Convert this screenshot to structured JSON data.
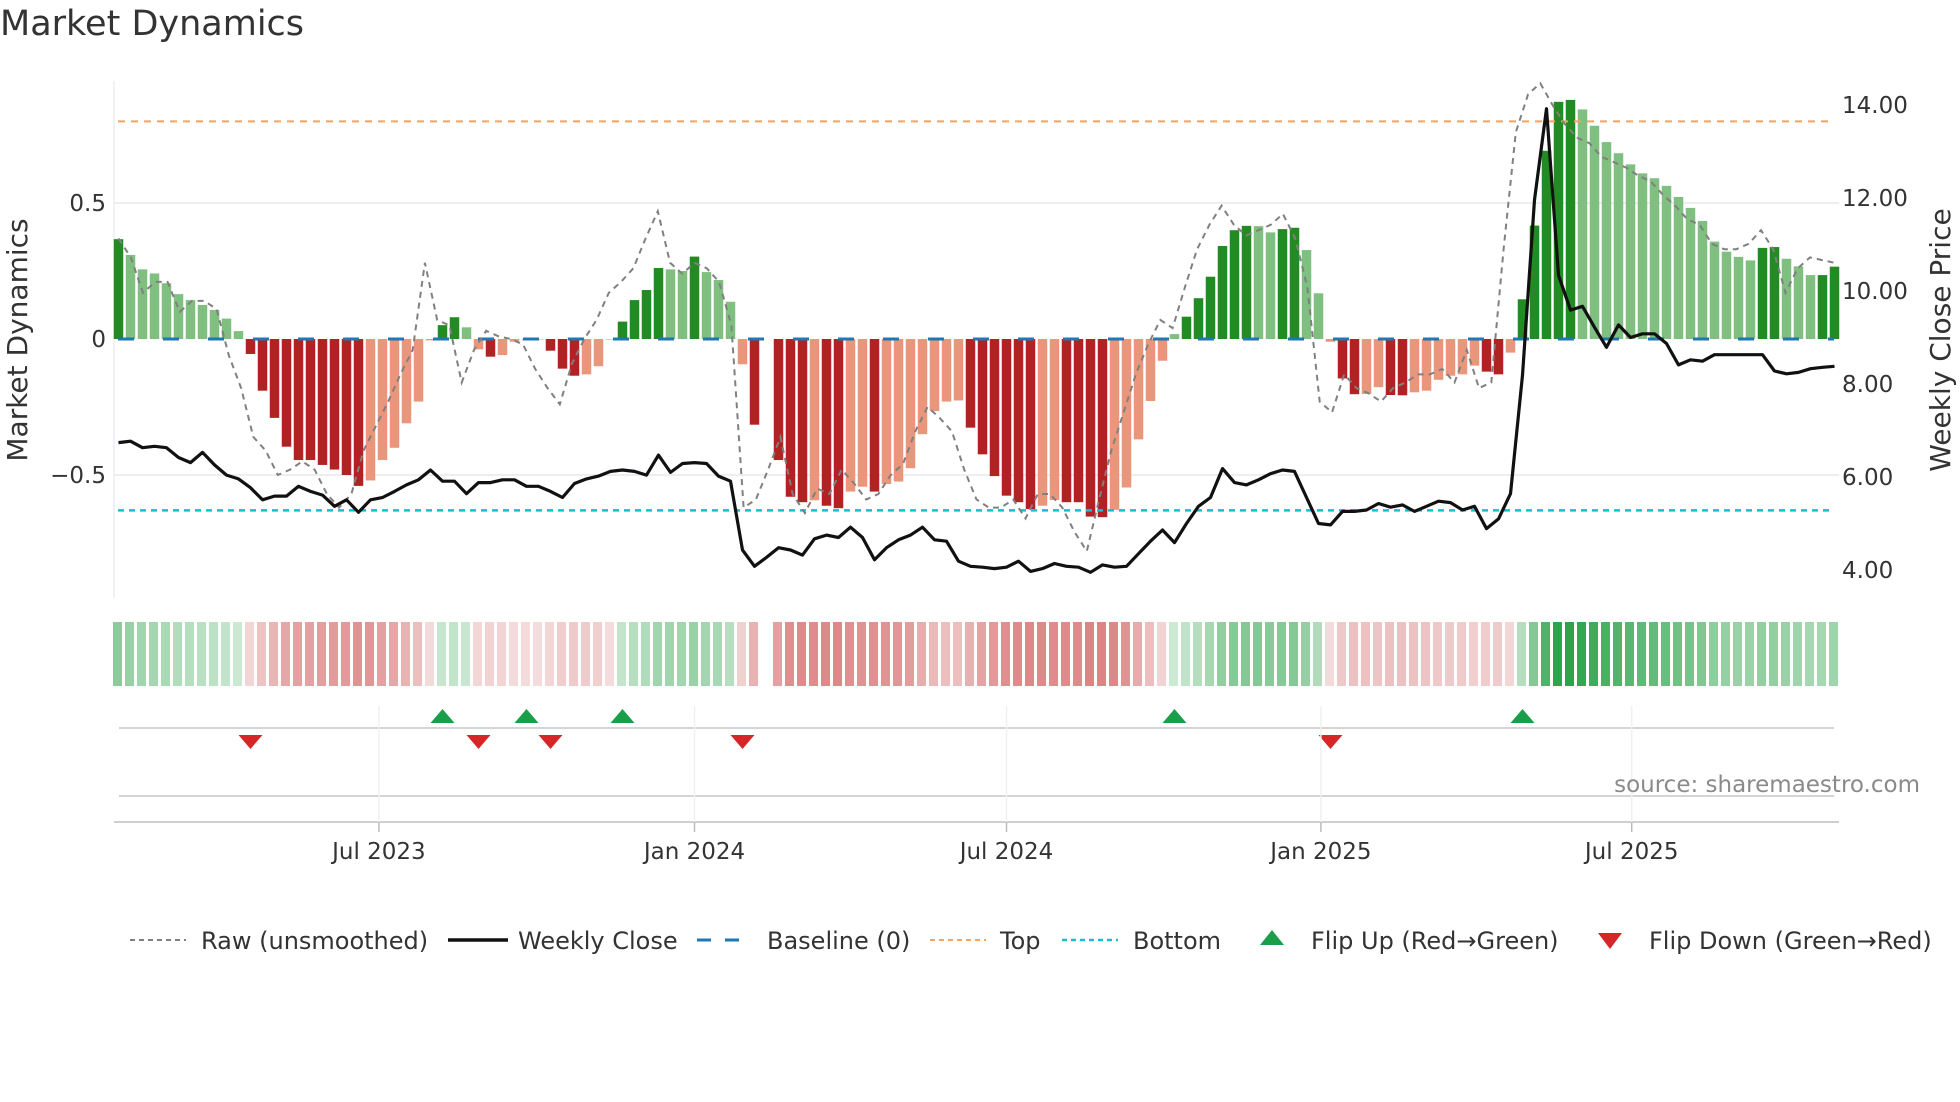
{
  "title": "Market Dynamics",
  "source": "source: sharemaestro.com",
  "chart_data": {
    "type": "bar",
    "title": "Market Dynamics",
    "ylabel": "Market Dynamics",
    "y2label": "Weekly Close Price",
    "ylim": [
      -0.9,
      1.0
    ],
    "y2lim": [
      3.3,
      14.6
    ],
    "frequency": "weekly",
    "yticks": [
      {
        "v": 0.5,
        "label": "0.5"
      },
      {
        "v": 0,
        "label": "0"
      },
      {
        "v": -0.5,
        "label": "−0.5"
      }
    ],
    "y2ticks": [
      {
        "v": 14,
        "label": "14.00"
      },
      {
        "v": 12,
        "label": "12.00"
      },
      {
        "v": 10,
        "label": "10.00"
      },
      {
        "v": 8,
        "label": "8.00"
      },
      {
        "v": 6,
        "label": "6.00"
      },
      {
        "v": 4,
        "label": "4.00"
      }
    ],
    "xticks": [
      {
        "week": 21.7,
        "label": "Jul 2023"
      },
      {
        "week": 48.0,
        "label": "Jan 2024"
      },
      {
        "week": 74.0,
        "label": "Jul 2024"
      },
      {
        "week": 100.2,
        "label": "Jan 2025"
      },
      {
        "week": 126.1,
        "label": "Jul 2025"
      }
    ],
    "levels": {
      "baseline": 0,
      "top": 0.8,
      "bottom": -0.63
    },
    "colors": {
      "strong_up": "#228b22",
      "weak_up": "#7fbf7f",
      "strong_down": "#b22222",
      "weak_down": "#e9967a",
      "baseline": "#1f77b4",
      "top": "#f4a460",
      "bottom": "#17becf",
      "raw": "#808080",
      "close": "#111111",
      "flip_up": "#1a9e4a",
      "flip_down": "#d62728"
    },
    "dynamics": [
      0.367,
      0.309,
      0.256,
      0.241,
      0.205,
      0.165,
      0.143,
      0.125,
      0.107,
      0.075,
      0.029,
      -0.055,
      -0.19,
      -0.29,
      -0.396,
      -0.445,
      -0.445,
      -0.463,
      -0.48,
      -0.5,
      -0.54,
      -0.52,
      -0.445,
      -0.4,
      -0.31,
      -0.23,
      -0.005,
      0.051,
      0.08,
      0.043,
      -0.038,
      -0.065,
      -0.059,
      -0.01,
      -0.003,
      -0.001,
      -0.043,
      -0.109,
      -0.135,
      -0.13,
      -0.1,
      -0.002,
      0.064,
      0.143,
      0.18,
      0.261,
      0.256,
      0.25,
      0.303,
      0.246,
      0.217,
      0.137,
      -0.093,
      -0.315,
      null,
      -0.445,
      -0.58,
      -0.6,
      -0.593,
      -0.613,
      -0.622,
      -0.561,
      -0.543,
      -0.561,
      -0.533,
      -0.524,
      -0.475,
      -0.35,
      -0.265,
      -0.23,
      -0.226,
      -0.326,
      -0.424,
      -0.504,
      -0.576,
      -0.6,
      -0.625,
      -0.613,
      -0.592,
      -0.6,
      -0.6,
      -0.653,
      -0.655,
      -0.628,
      -0.546,
      -0.369,
      -0.228,
      -0.08,
      0.018,
      0.082,
      0.15,
      0.229,
      0.342,
      0.4,
      0.416,
      0.415,
      0.392,
      0.404,
      0.409,
      0.327,
      0.168,
      -0.01,
      -0.145,
      -0.203,
      -0.202,
      -0.177,
      -0.206,
      -0.207,
      -0.196,
      -0.19,
      -0.15,
      -0.135,
      -0.13,
      -0.098,
      -0.12,
      -0.13,
      -0.05,
      0.146,
      0.417,
      0.692,
      0.872,
      0.879,
      0.844,
      0.784,
      0.724,
      0.683,
      0.642,
      0.609,
      0.591,
      0.563,
      0.522,
      0.482,
      0.434,
      0.358,
      0.321,
      0.302,
      0.289,
      0.335,
      0.338,
      0.295,
      0.267,
      0.235,
      0.235,
      0.266
    ],
    "raw": [
      0.37,
      0.3,
      0.17,
      0.21,
      0.21,
      0.1,
      0.14,
      0.14,
      0.11,
      -0.06,
      -0.18,
      -0.36,
      -0.41,
      -0.5,
      -0.48,
      -0.45,
      -0.48,
      -0.57,
      -0.62,
      -0.57,
      -0.41,
      -0.32,
      -0.23,
      -0.13,
      -0.04,
      0.28,
      0.07,
      0.05,
      -0.16,
      -0.04,
      0.03,
      0.01,
      0,
      -0.02,
      -0.11,
      -0.18,
      -0.24,
      -0.09,
      0,
      0.07,
      0.17,
      0.21,
      0.26,
      0.37,
      0.47,
      0.28,
      0.24,
      0.28,
      0.26,
      0.21,
      0.05,
      -0.62,
      -0.59,
      -0.48,
      -0.36,
      -0.57,
      -0.64,
      -0.55,
      -0.57,
      -0.48,
      -0.53,
      -0.59,
      -0.57,
      -0.5,
      -0.46,
      -0.34,
      -0.25,
      -0.29,
      -0.34,
      -0.48,
      -0.59,
      -0.62,
      -0.62,
      -0.59,
      -0.66,
      -0.57,
      -0.57,
      -0.62,
      -0.71,
      -0.78,
      -0.59,
      -0.41,
      -0.27,
      -0.13,
      -0.02,
      0.07,
      0.04,
      0.19,
      0.33,
      0.42,
      0.49,
      0.42,
      0.38,
      0.4,
      0.42,
      0.46,
      0.37,
      0.19,
      -0.23,
      -0.27,
      -0.13,
      -0.18,
      -0.2,
      -0.23,
      -0.18,
      -0.16,
      -0.13,
      -0.13,
      -0.11,
      -0.16,
      -0.04,
      -0.18,
      -0.16,
      0.33,
      0.76,
      0.9,
      0.94,
      0.86,
      0.79,
      0.74,
      0.72,
      0.67,
      0.65,
      0.63,
      0.6,
      0.58,
      0.53,
      0.49,
      0.44,
      0.42,
      0.35,
      0.33,
      0.33,
      0.35,
      0.4,
      0.33,
      0.17,
      0.26,
      0.3,
      0.29,
      0.28
    ],
    "close": [
      6.74,
      6.77,
      6.63,
      6.66,
      6.63,
      6.42,
      6.31,
      6.53,
      6.26,
      6.04,
      5.96,
      5.77,
      5.51,
      5.59,
      5.59,
      5.8,
      5.69,
      5.61,
      5.37,
      5.51,
      5.24,
      5.51,
      5.56,
      5.69,
      5.83,
      5.94,
      6.15,
      5.91,
      5.91,
      5.64,
      5.88,
      5.88,
      5.94,
      5.94,
      5.8,
      5.8,
      5.69,
      5.56,
      5.86,
      5.96,
      6.02,
      6.12,
      6.15,
      6.12,
      6.04,
      6.47,
      6.1,
      6.29,
      6.31,
      6.29,
      6.02,
      5.91,
      4.43,
      4.08,
      4.27,
      4.48,
      4.43,
      4.32,
      4.67,
      4.75,
      4.7,
      4.92,
      4.7,
      4.22,
      4.48,
      4.65,
      4.75,
      4.92,
      4.65,
      4.62,
      4.19,
      4.08,
      4.06,
      4.03,
      4.06,
      4.19,
      3.97,
      4.03,
      4.14,
      4.08,
      4.06,
      3.95,
      4.11,
      4.06,
      4.08,
      4.35,
      4.62,
      4.86,
      4.59,
      5.0,
      5.37,
      5.56,
      6.18,
      5.88,
      5.83,
      5.94,
      6.07,
      6.15,
      6.12,
      5.56,
      5.0,
      4.97,
      5.26,
      5.26,
      5.29,
      5.43,
      5.35,
      5.4,
      5.26,
      5.37,
      5.48,
      5.45,
      5.29,
      5.37,
      4.89,
      5.1,
      5.64,
      8.19,
      11.96,
      13.92,
      10.34,
      9.59,
      9.67,
      9.22,
      8.79,
      9.27,
      9.0,
      9.08,
      9.08,
      8.87,
      8.41,
      8.52,
      8.49,
      8.63,
      8.63,
      8.63,
      8.63,
      8.63,
      8.28,
      8.22,
      8.25,
      8.33,
      8.36,
      8.38
    ],
    "flips": [
      {
        "week": 11,
        "dir": "down"
      },
      {
        "week": 27,
        "dir": "up"
      },
      {
        "week": 30,
        "dir": "down"
      },
      {
        "week": 34,
        "dir": "up"
      },
      {
        "week": 36,
        "dir": "down"
      },
      {
        "week": 42,
        "dir": "up"
      },
      {
        "week": 52,
        "dir": "down"
      },
      {
        "week": 88,
        "dir": "up"
      },
      {
        "week": 101,
        "dir": "down"
      },
      {
        "week": 117,
        "dir": "up"
      }
    ],
    "legend": {
      "placement": "bottom",
      "items": [
        {
          "key": "raw",
          "label": "Raw (unsmoothed)"
        },
        {
          "key": "close",
          "label": "Weekly Close"
        },
        {
          "key": "baseline",
          "label": "Baseline (0)"
        },
        {
          "key": "top",
          "label": "Top"
        },
        {
          "key": "bottom",
          "label": "Bottom"
        },
        {
          "key": "flip_up",
          "label": "Flip Up (Red→Green)"
        },
        {
          "key": "flip_down",
          "label": "Flip Down (Green→Red)"
        }
      ]
    }
  }
}
